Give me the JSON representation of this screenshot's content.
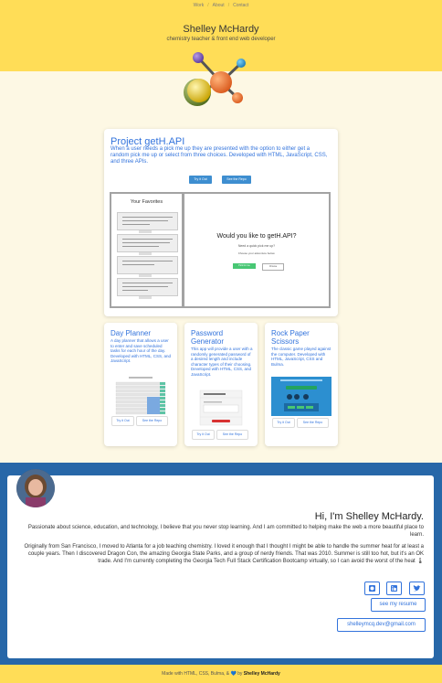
{
  "nav": {
    "work": "Work",
    "about": "About",
    "contact": "Contact",
    "separator": "/"
  },
  "hero": {
    "name": "Shelley McHardy",
    "tagline": "chemistry teacher & front end web developer"
  },
  "featured": {
    "title": "Project getH.API",
    "description": "When a user needs a pick me up they are presented with the option to either get a random pick me up or select from three choices. Developed with HTML, JavaScript, CSS, and three APIs.",
    "try_label": "Try it Out",
    "repo_label": "See the Repo",
    "screenshot": {
      "favorites_title": "Your Favorites",
      "question": "Would you like to getH.API?",
      "subquestion": "Need a quick pick me up?",
      "choose_text": "Choose your adventure below.",
      "pick_label": "Pick for me",
      "choose_label": "Choose"
    }
  },
  "projects": [
    {
      "title": "Day Planner",
      "description": "A day planner that allows a user to enter and save scheduled tasks for each hour of the day. Developed with HTML, CSS, and JavaScript.",
      "try_label": "Try it Out",
      "repo_label": "See the Repo"
    },
    {
      "title": "Password Generator",
      "description": "This app will provide a user with a randomly generated password of a desired length and include character types of their choosing. Developed with HTML, CSS, and JavaScript.",
      "try_label": "Try it Out",
      "repo_label": "See the Repo"
    },
    {
      "title": "Rock Paper Scissors",
      "description": "The classic game played against the computer. Developed with HTML, JavaScript, CSS and Bulma.",
      "try_label": "Try it Out",
      "repo_label": "See the Repo"
    }
  ],
  "about": {
    "greeting": "Hi, I'm Shelley McHardy.",
    "para1": "Passionate about science, education, and technology, I believe that you never stop learning. And I am committed to helping make the web a more beautiful place to learn.",
    "para2": "Originally from San Francisco, I moved to Atlanta for a job teaching chemistry. I loved it enough that I thought I might be able to handle the summer heat for at least a couple years. Then I discovered Dragon Con, the amazing Georgia State Parks, and a group of nerdy friends. That was 2010. Summer is still too hot, but it's an OK trade. And I'm currently completing the Georgia Tech Full Stack Certification Bootcamp virtually, so I can avoid the worst of the heat 🌡",
    "resume_label": "see my resume",
    "email_label": "shelleymcq.dev@gmail.com"
  },
  "footer": {
    "prefix": "Made with HTML, CSS, Bulma, &",
    "heart": "💙",
    "by": "by",
    "name": "Shelley McHardy"
  },
  "colors": {
    "hero": "#ffdd57",
    "link": "#3273dc",
    "about_bg": "#2767a8",
    "button": "#3e8ed0"
  },
  "icons": [
    "github-icon",
    "linkedin-icon",
    "twitter-icon"
  ]
}
